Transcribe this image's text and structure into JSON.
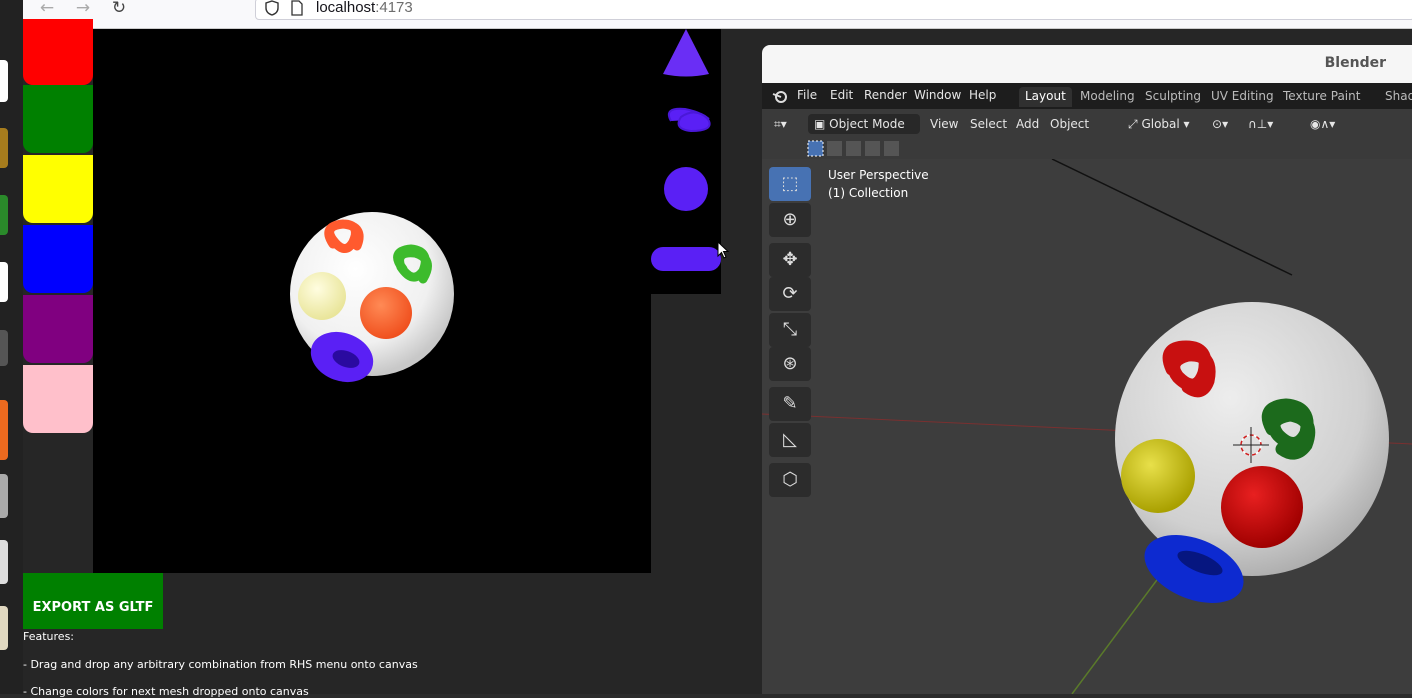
{
  "browser": {
    "back_icon": "arrow-left-icon",
    "forward_icon": "arrow-right-icon",
    "reload_icon": "reload-icon",
    "url_host": "localhost",
    "url_port": ":4173"
  },
  "app": {
    "swatch_colors": [
      "#ff0000",
      "#008000",
      "#ffff00",
      "#0000ff",
      "#800080",
      "#ffc0cb"
    ],
    "menu_shapes": [
      "cone",
      "knot",
      "sphere",
      "capsule"
    ],
    "export_label": "EXPORT AS GLTF",
    "features_title": "Features:",
    "features": [
      "- Drag and drop any arbitrary combination from RHS menu onto canvas",
      "- Change colors for next mesh dropped onto canvas"
    ]
  },
  "blender": {
    "title": "Blender",
    "menu": [
      "File",
      "Edit",
      "Render",
      "Window",
      "Help"
    ],
    "workspaces": [
      "Layout",
      "Modeling",
      "Sculpting",
      "UV Editing",
      "Texture Paint",
      "Shading"
    ],
    "active_workspace": "Layout",
    "mode": "Object Mode",
    "header_menu": [
      "View",
      "Select",
      "Add",
      "Object"
    ],
    "orientation": "Global",
    "viewport_label": "User Perspective",
    "collection_label": "(1) Collection"
  }
}
